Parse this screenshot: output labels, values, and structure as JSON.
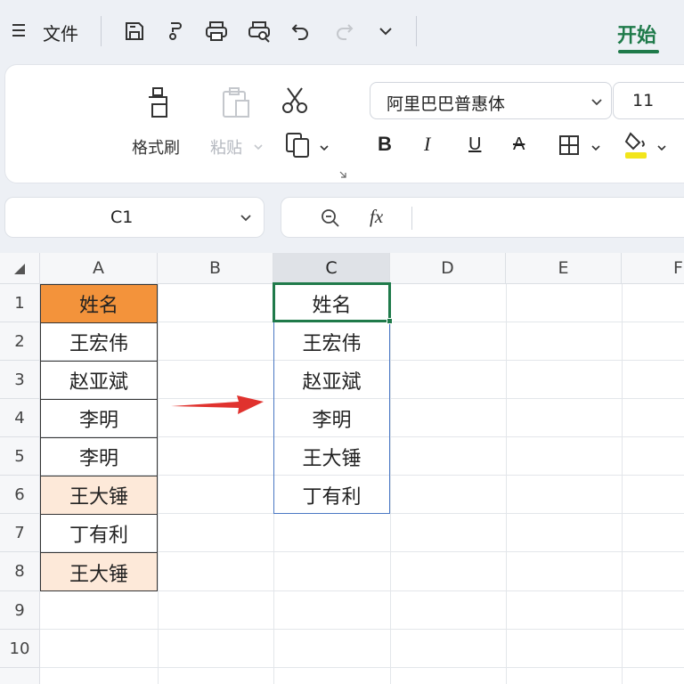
{
  "menu": {
    "file_label": "文件",
    "home_tab_label": "开始",
    "toolbar_icons": [
      "save-icon",
      "format-painter-icon",
      "print-icon",
      "print-preview-icon",
      "undo-icon",
      "redo-icon",
      "more-chevron-icon"
    ]
  },
  "ribbon": {
    "format_painter_label": "格式刷",
    "paste_label": "粘贴",
    "font_name": "阿里巴巴普惠体",
    "font_size": "11",
    "bold_glyph": "B",
    "italic_glyph": "I",
    "underline_glyph": "U",
    "strike_glyph": "A"
  },
  "formula_bar": {
    "cell_ref": "C1",
    "fx_label": "fx"
  },
  "grid": {
    "columns": [
      "A",
      "B",
      "C",
      "D",
      "E",
      "F"
    ],
    "selected_column": "C",
    "rows": [
      "1",
      "2",
      "3",
      "4",
      "5",
      "6",
      "7",
      "8",
      "9",
      "10"
    ],
    "column_a": [
      "姓名",
      "王宏伟",
      "赵亚斌",
      "李明",
      "李明",
      "王大锤",
      "丁有利",
      "王大锤"
    ],
    "column_c": [
      "姓名",
      "王宏伟",
      "赵亚斌",
      "李明",
      "王大锤",
      "丁有利"
    ],
    "active_cell": "C1"
  },
  "colors": {
    "accent": "#1f7a4a",
    "header_fill": "#f3933b",
    "duplicate_fill": "#fde9d9",
    "arrow": "#e0322e",
    "highlight_yellow": "#f2e51b"
  }
}
